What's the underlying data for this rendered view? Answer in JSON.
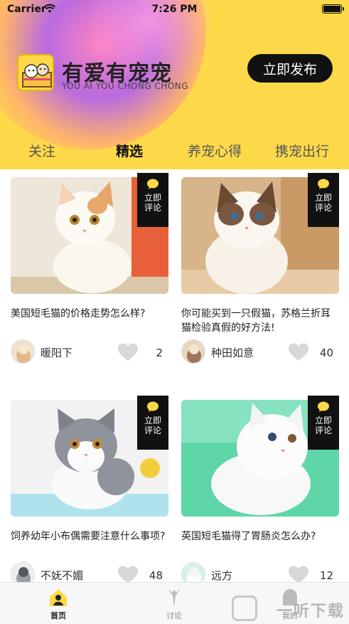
{
  "status_bar": {
    "carrier": "Carrier",
    "time": "7:26 PM"
  },
  "header": {
    "title": "有爱有宠宠",
    "subtitle": "YOU AI YOU CHONG CHONG",
    "publish_button": "立即发布"
  },
  "tabs": [
    {
      "label": "关注",
      "active": false
    },
    {
      "label": "精选",
      "active": true
    },
    {
      "label": "养宠心得",
      "active": false
    },
    {
      "label": "携宠出行",
      "active": false
    }
  ],
  "comment_badge": {
    "line1": "立即",
    "line2": "评论"
  },
  "posts": [
    {
      "title": "美国短毛猫的价格走势怎么样?",
      "user": "暖阳下",
      "likes": "2",
      "image": "orange-white-kitten"
    },
    {
      "title": "你可能买到一只假猫，苏格兰折耳猫检验真假的好方法!",
      "user": "种田如意",
      "likes": "40",
      "image": "ragdoll-cat"
    },
    {
      "title": "饲养幼年小布偶需要注意什么事项?",
      "user": "不妩不媚",
      "likes": "48",
      "image": "grey-white-kitten"
    },
    {
      "title": "英国短毛猫得了胃肠炎怎么办?",
      "user": "远方",
      "likes": "12",
      "image": "white-persian-kitten"
    }
  ],
  "tabbar": [
    {
      "label": "首页",
      "icon": "home-icon",
      "active": true
    },
    {
      "label": "讨论",
      "icon": "discuss-icon",
      "active": false
    },
    {
      "label": "我的",
      "icon": "profile-icon",
      "active": false
    }
  ],
  "watermark": "一听下载",
  "colors": {
    "brand_yellow": "#fdd94a",
    "dark": "#111111"
  }
}
